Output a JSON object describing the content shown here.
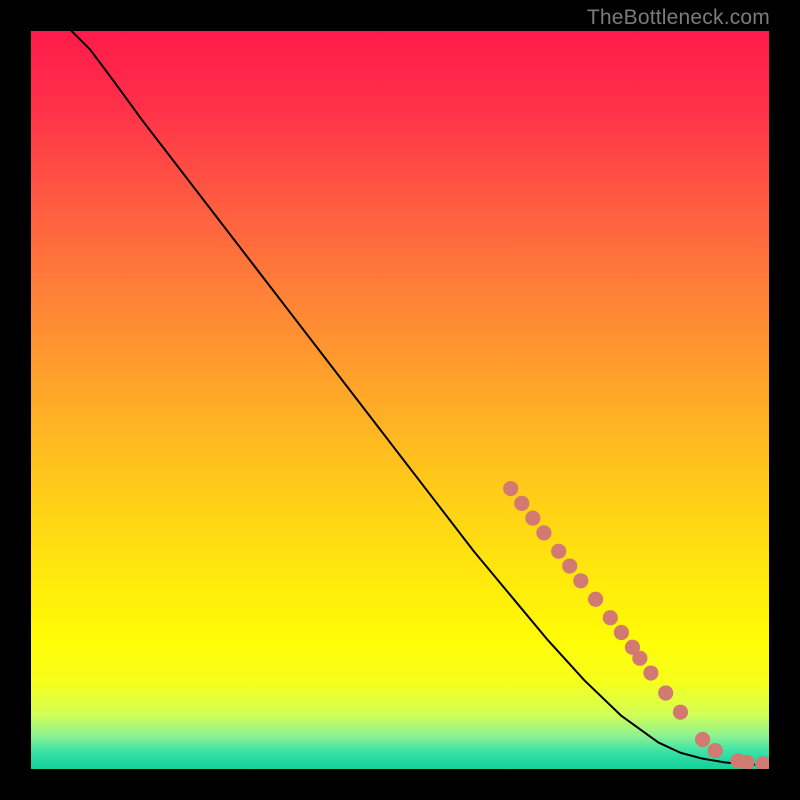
{
  "attribution": "TheBottleneck.com",
  "gradient_stops": [
    {
      "offset": 0.0,
      "color": "#ff1a4b"
    },
    {
      "offset": 0.1,
      "color": "#ff3049"
    },
    {
      "offset": 0.22,
      "color": "#ff5742"
    },
    {
      "offset": 0.35,
      "color": "#ff7f38"
    },
    {
      "offset": 0.48,
      "color": "#ffa42a"
    },
    {
      "offset": 0.6,
      "color": "#ffc61b"
    },
    {
      "offset": 0.72,
      "color": "#ffe40e"
    },
    {
      "offset": 0.82,
      "color": "#fffb05"
    },
    {
      "offset": 0.88,
      "color": "#f7ff1a"
    },
    {
      "offset": 0.925,
      "color": "#d4ff55"
    },
    {
      "offset": 0.955,
      "color": "#8cf290"
    },
    {
      "offset": 0.975,
      "color": "#3fe3a6"
    },
    {
      "offset": 0.99,
      "color": "#1fd7a0"
    },
    {
      "offset": 1.0,
      "color": "#17d19c"
    }
  ],
  "chart_data": {
    "type": "line",
    "title": "",
    "xlabel": "",
    "ylabel": "",
    "xlim": [
      0,
      100
    ],
    "ylim": [
      0,
      100
    ],
    "grid": false,
    "series": [
      {
        "name": "curve",
        "x": [
          5.5,
          8,
          11,
          15,
          20,
          25,
          30,
          35,
          40,
          45,
          50,
          55,
          60,
          65,
          70,
          75,
          80,
          85,
          88,
          91,
          94,
          96,
          98
        ],
        "y": [
          100,
          97.5,
          93.5,
          88,
          81.5,
          75,
          68.5,
          62,
          55.5,
          49,
          42.5,
          36,
          29.5,
          23.5,
          17.5,
          12,
          7.2,
          3.6,
          2.2,
          1.4,
          0.9,
          0.7,
          0.6
        ],
        "stroke": "#000000",
        "stroke_width": 2
      }
    ],
    "markers": [
      {
        "x": 65.0,
        "y": 38.0
      },
      {
        "x": 66.5,
        "y": 36.0
      },
      {
        "x": 68.0,
        "y": 34.0
      },
      {
        "x": 69.5,
        "y": 32.0
      },
      {
        "x": 71.5,
        "y": 29.5
      },
      {
        "x": 73.0,
        "y": 27.5
      },
      {
        "x": 74.5,
        "y": 25.5
      },
      {
        "x": 76.5,
        "y": 23.0
      },
      {
        "x": 78.5,
        "y": 20.5
      },
      {
        "x": 80.0,
        "y": 18.5
      },
      {
        "x": 81.5,
        "y": 16.5
      },
      {
        "x": 82.5,
        "y": 15.0
      },
      {
        "x": 84.0,
        "y": 13.0
      },
      {
        "x": 86.0,
        "y": 10.3
      },
      {
        "x": 88.0,
        "y": 7.7
      },
      {
        "x": 91.0,
        "y": 4.0
      },
      {
        "x": 92.7,
        "y": 2.5
      },
      {
        "x": 95.8,
        "y": 1.1
      },
      {
        "x": 97.0,
        "y": 0.9
      },
      {
        "x": 99.2,
        "y": 0.7
      }
    ],
    "marker_style": {
      "fill": "#d27a72",
      "radius": 7.6
    }
  }
}
